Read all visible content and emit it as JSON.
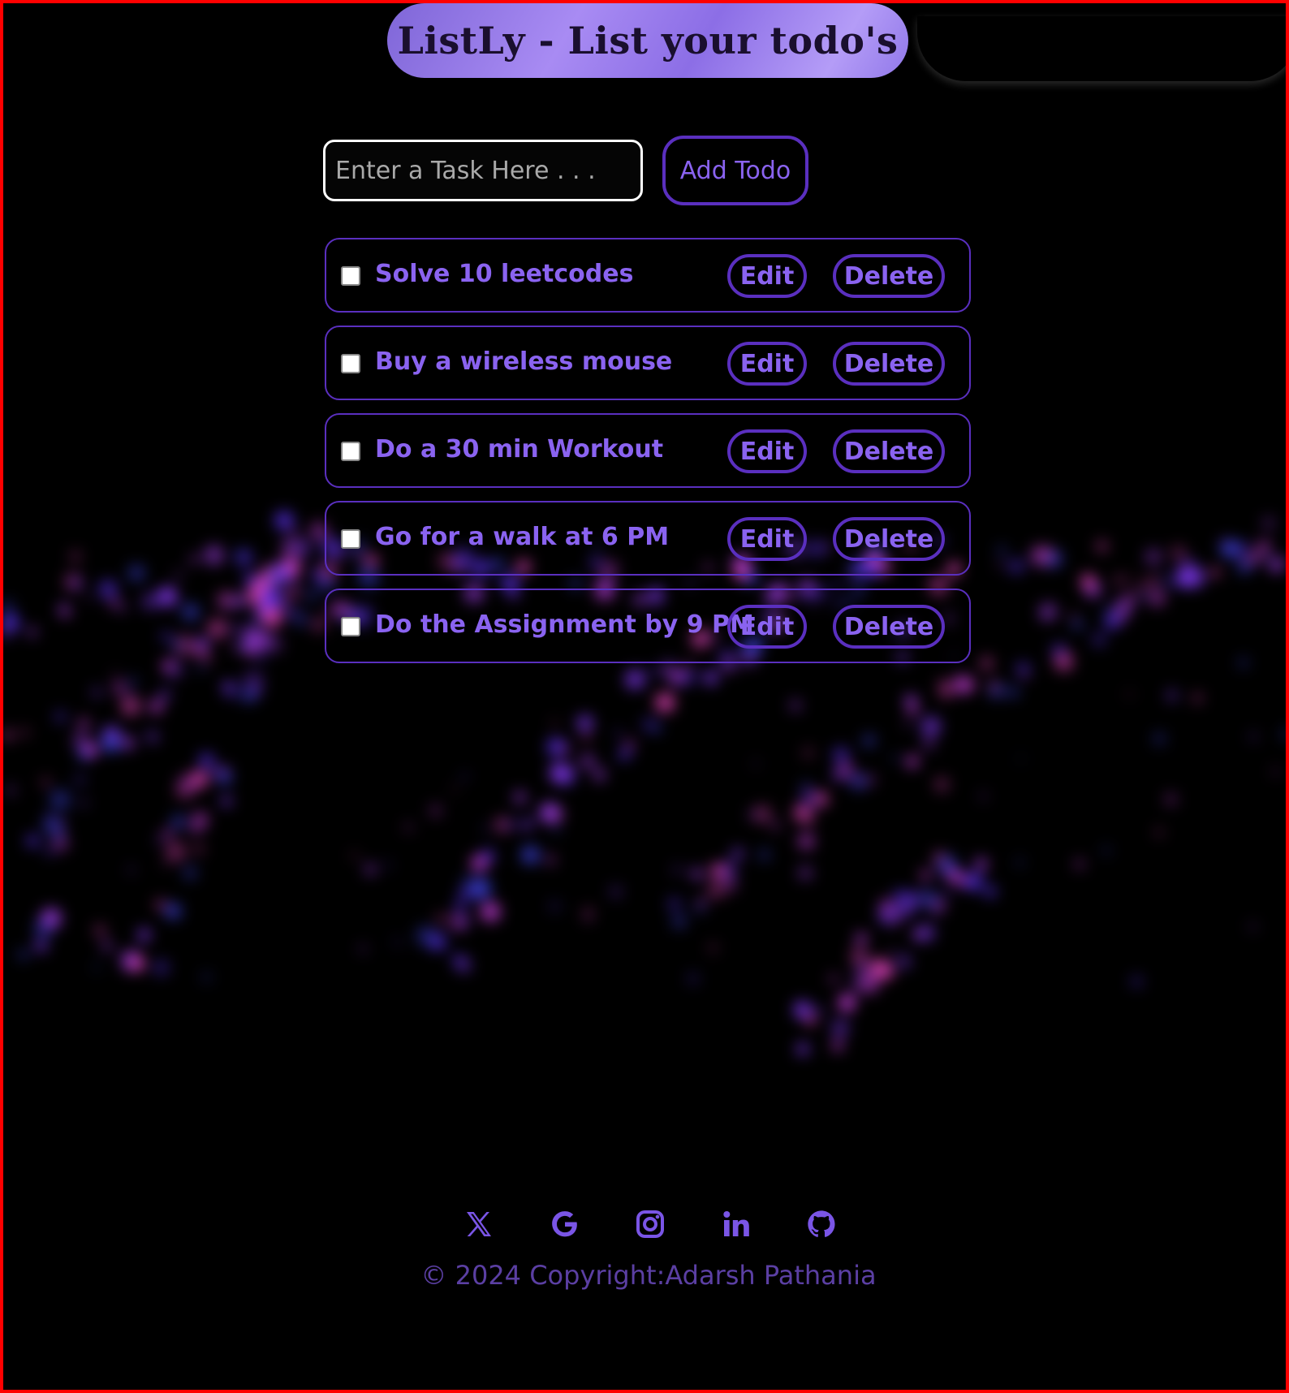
{
  "header": {
    "title": "ListLy - List your todo's"
  },
  "input": {
    "placeholder": "Enter a Task Here . . ."
  },
  "add_button": {
    "label": "Add Todo"
  },
  "todos": [
    {
      "text": "Solve 10 leetcodes",
      "checked": false,
      "edit_label": "Edit",
      "delete_label": "Delete"
    },
    {
      "text": "Buy a wireless mouse",
      "checked": false,
      "edit_label": "Edit",
      "delete_label": "Delete"
    },
    {
      "text": "Do a 30 min Workout",
      "checked": false,
      "edit_label": "Edit",
      "delete_label": "Delete"
    },
    {
      "text": "Go for a walk at 6 PM",
      "checked": false,
      "edit_label": "Edit",
      "delete_label": "Delete"
    },
    {
      "text": "Do the Assignment by 9 PM",
      "checked": false,
      "edit_label": "Edit",
      "delete_label": "Delete"
    }
  ],
  "footer": {
    "social_icons": [
      "x-icon",
      "google-icon",
      "instagram-icon",
      "linkedin-icon",
      "github-icon"
    ],
    "copyright": "© 2024 Copyright:Adarsh Pathania"
  },
  "colors": {
    "accent": "#8a63f0",
    "border": "#5a2fbf",
    "background": "#000000",
    "frame": "#ff0000"
  }
}
